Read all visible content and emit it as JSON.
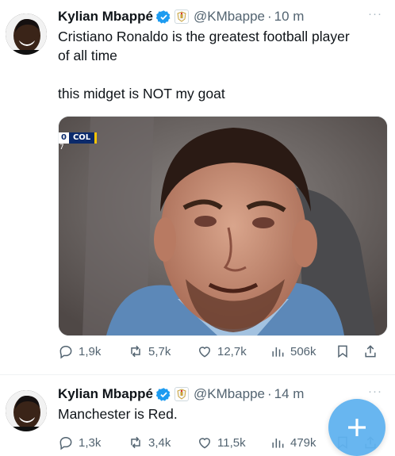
{
  "colors": {
    "accent": "#1d9bf0",
    "muted": "#536471",
    "text": "#0f1419",
    "fab": "#60b3f0"
  },
  "tweets": [
    {
      "author": {
        "name": "Kylian Mbappé",
        "handle": "@KMbappe",
        "verified": true,
        "affiliate_icon": "club-badge-icon"
      },
      "time": "10 m",
      "more": "···",
      "text": "Cristiano Ronaldo is the greatest football player\nof all time\n\nthis midget is NOT my goat",
      "media": {
        "scorebug_score": "0",
        "scorebug_team": "COL",
        "scorebug_sub": "7"
      },
      "stats": {
        "replies": "1,9k",
        "reposts": "5,7k",
        "likes": "12,7k",
        "views": "506k"
      }
    },
    {
      "author": {
        "name": "Kylian Mbappé",
        "handle": "@KMbappe",
        "verified": true,
        "affiliate_icon": "club-badge-icon"
      },
      "time": "14 m",
      "more": "···",
      "text": "Manchester is Red.",
      "stats": {
        "replies": "1,3k",
        "reposts": "3,4k",
        "likes": "11,5k",
        "views": "479k"
      }
    }
  ],
  "separator": "·",
  "fab_icon": "compose-plus-icon"
}
